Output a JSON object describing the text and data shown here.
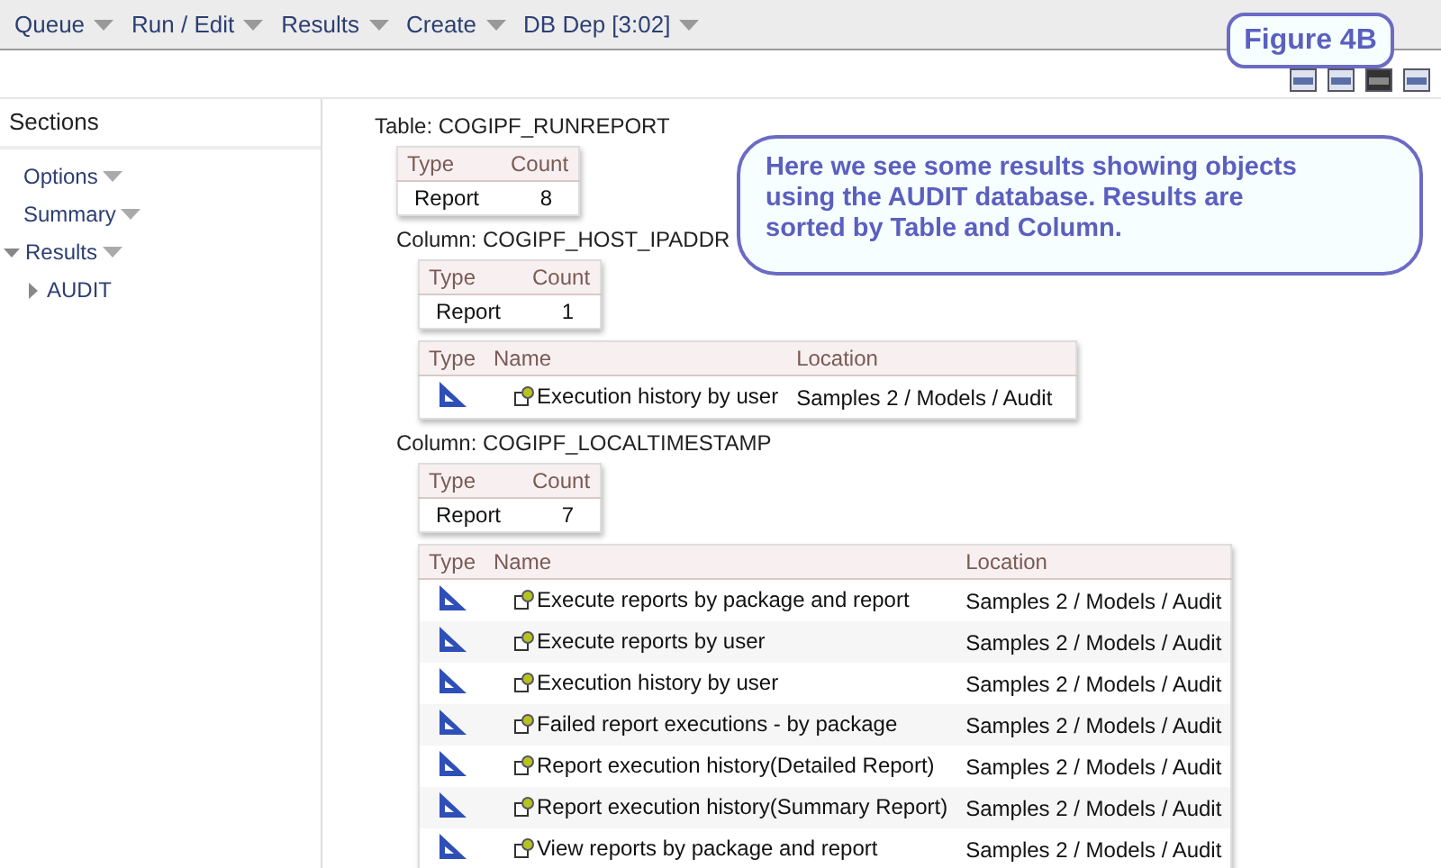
{
  "menu": [
    {
      "label": "Queue"
    },
    {
      "label": "Run / Edit"
    },
    {
      "label": "Results"
    },
    {
      "label": "Create"
    },
    {
      "label": "DB Dep [3:02]"
    }
  ],
  "figure_label": "Figure 4B",
  "callout": "Here we see some results showing objects using the AUDIT database. Results are sorted by Table and Column.",
  "sidebar": {
    "title": "Sections",
    "items": [
      {
        "label": "Options",
        "menu": true
      },
      {
        "label": "Summary",
        "menu": true
      },
      {
        "label": "Results",
        "menu": true,
        "expanded": true,
        "children": [
          {
            "label": "AUDIT",
            "menu": false,
            "expanded": false
          }
        ]
      }
    ]
  },
  "groups": [
    {
      "kind": "table",
      "heading": "Table: COGIPF_RUNREPORT",
      "summary": {
        "columns": [
          "Type",
          "Count"
        ],
        "rows": [
          [
            "Report",
            "8"
          ]
        ]
      }
    },
    {
      "kind": "column",
      "heading": "Column: COGIPF_HOST_IPADDR",
      "summary": {
        "columns": [
          "Type",
          "Count"
        ],
        "rows": [
          [
            "Report",
            "1"
          ]
        ]
      },
      "objects": {
        "columns": [
          "Type",
          "Name",
          "Location"
        ],
        "rows": [
          {
            "name": "Execution history by user",
            "location": "Samples 2 / Models / Audit"
          }
        ]
      }
    },
    {
      "kind": "column",
      "heading": "Column: COGIPF_LOCALTIMESTAMP",
      "summary": {
        "columns": [
          "Type",
          "Count"
        ],
        "rows": [
          [
            "Report",
            "7"
          ]
        ]
      },
      "objects": {
        "columns": [
          "Type",
          "Name",
          "Location"
        ],
        "rows": [
          {
            "name": "Execute reports by package and report",
            "location": "Samples 2 / Models / Audit"
          },
          {
            "name": "Execute reports by user",
            "location": "Samples 2 / Models / Audit"
          },
          {
            "name": "Execution history by user",
            "location": "Samples 2 / Models / Audit"
          },
          {
            "name": "Failed report executions - by package",
            "location": "Samples 2 / Models / Audit"
          },
          {
            "name": "Report execution history(Detailed Report)",
            "location": "Samples 2 / Models / Audit"
          },
          {
            "name": "Report execution history(Summary Report)",
            "location": "Samples 2 / Models / Audit"
          },
          {
            "name": "View reports by package and report",
            "location": "Samples 2 / Models / Audit"
          }
        ]
      }
    }
  ]
}
